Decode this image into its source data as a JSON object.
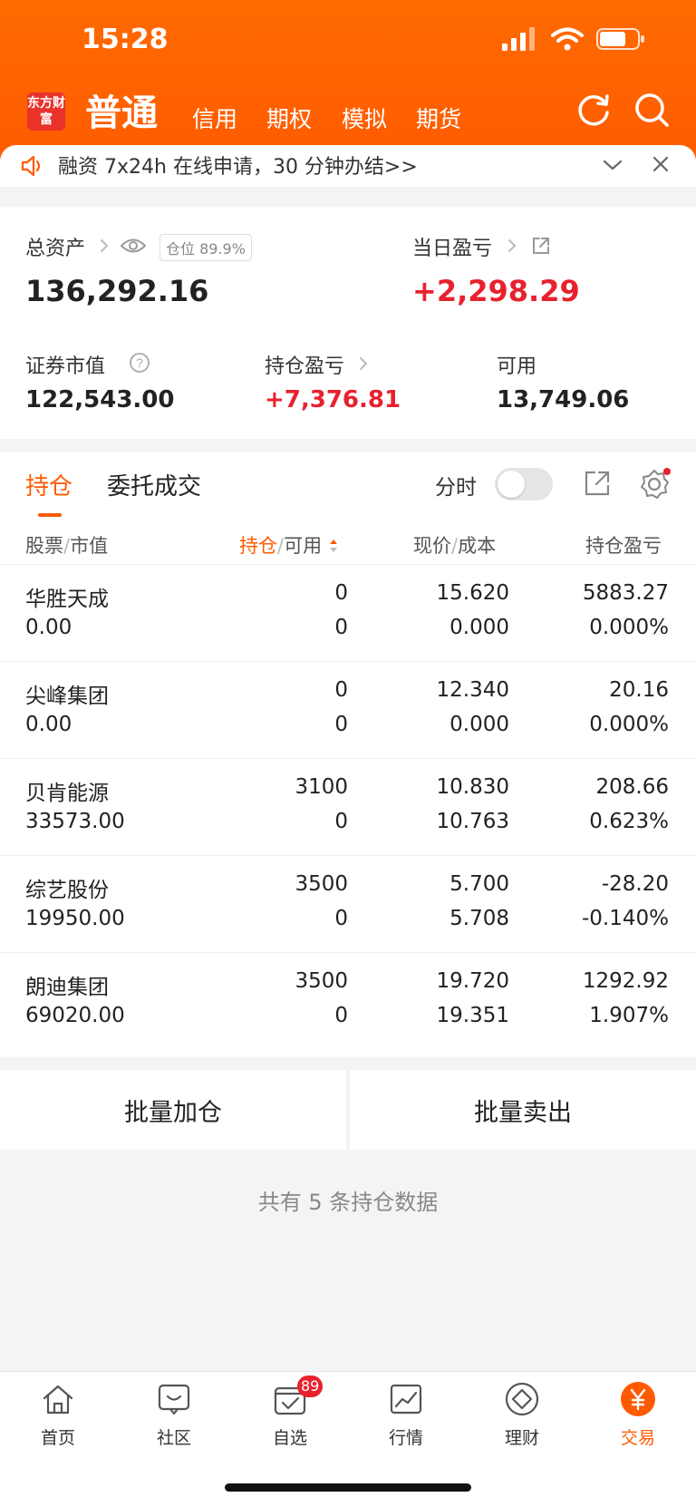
{
  "status": {
    "time": "15:28"
  },
  "nav": {
    "logo": "东方财富",
    "main_tab": "普通",
    "tabs": [
      "信用",
      "期权",
      "模拟",
      "期货"
    ]
  },
  "notice": {
    "text": "融资 7x24h 在线申请，30 分钟办结>>"
  },
  "summary": {
    "total_assets_label": "总资产",
    "position_badge": "仓位 89.9%",
    "total_assets_value": "136,292.16",
    "daily_pl_label": "当日盈亏",
    "daily_pl_value": "+2,298.29",
    "securities_value_label": "证券市值",
    "securities_value": "122,543.00",
    "holding_pl_label": "持仓盈亏",
    "holding_pl_value": "+7,376.81",
    "available_label": "可用",
    "available_value": "13,749.06"
  },
  "holdings": {
    "tab_active": "持仓",
    "tab_inactive": "委托成交",
    "toggle_label": "分时",
    "headers": {
      "stock": "股票",
      "market_value": "市值",
      "position": "持仓",
      "available": "可用",
      "price": "现价",
      "cost": "成本",
      "pl": "持仓盈亏"
    },
    "rows": [
      {
        "name": "华胜天成",
        "value": "0.00",
        "pos": "0",
        "avail": "0",
        "price": "15.620",
        "cost": "0.000",
        "pl": "5883.27",
        "pct": "0.000%",
        "trend": "up"
      },
      {
        "name": "尖峰集团",
        "value": "0.00",
        "pos": "0",
        "avail": "0",
        "price": "12.340",
        "cost": "0.000",
        "pl": "20.16",
        "pct": "0.000%",
        "trend": "up"
      },
      {
        "name": "贝肯能源",
        "value": "33573.00",
        "pos": "3100",
        "avail": "0",
        "price": "10.830",
        "cost": "10.763",
        "pl": "208.66",
        "pct": "0.623%",
        "trend": "up"
      },
      {
        "name": "综艺股份",
        "value": "19950.00",
        "pos": "3500",
        "avail": "0",
        "price": "5.700",
        "cost": "5.708",
        "pl": "-28.20",
        "pct": "-0.140%",
        "trend": "down"
      },
      {
        "name": "朗迪集团",
        "value": "69020.00",
        "pos": "3500",
        "avail": "0",
        "price": "19.720",
        "cost": "19.351",
        "pl": "1292.92",
        "pct": "1.907%",
        "trend": "up"
      }
    ]
  },
  "actions": {
    "add": "批量加仓",
    "sell": "批量卖出"
  },
  "footer_count": "共有 5 条持仓数据",
  "tabbar": {
    "items": [
      {
        "label": "首页",
        "icon": "home-icon"
      },
      {
        "label": "社区",
        "icon": "community-icon"
      },
      {
        "label": "自选",
        "icon": "watchlist-icon",
        "badge": "89"
      },
      {
        "label": "行情",
        "icon": "market-icon"
      },
      {
        "label": "理财",
        "icon": "wealth-icon"
      },
      {
        "label": "交易",
        "icon": "trade-icon",
        "active": true
      }
    ]
  },
  "colors": {
    "brand": "#ff5a00",
    "up": "#e8212e",
    "down": "#1a9b22"
  }
}
